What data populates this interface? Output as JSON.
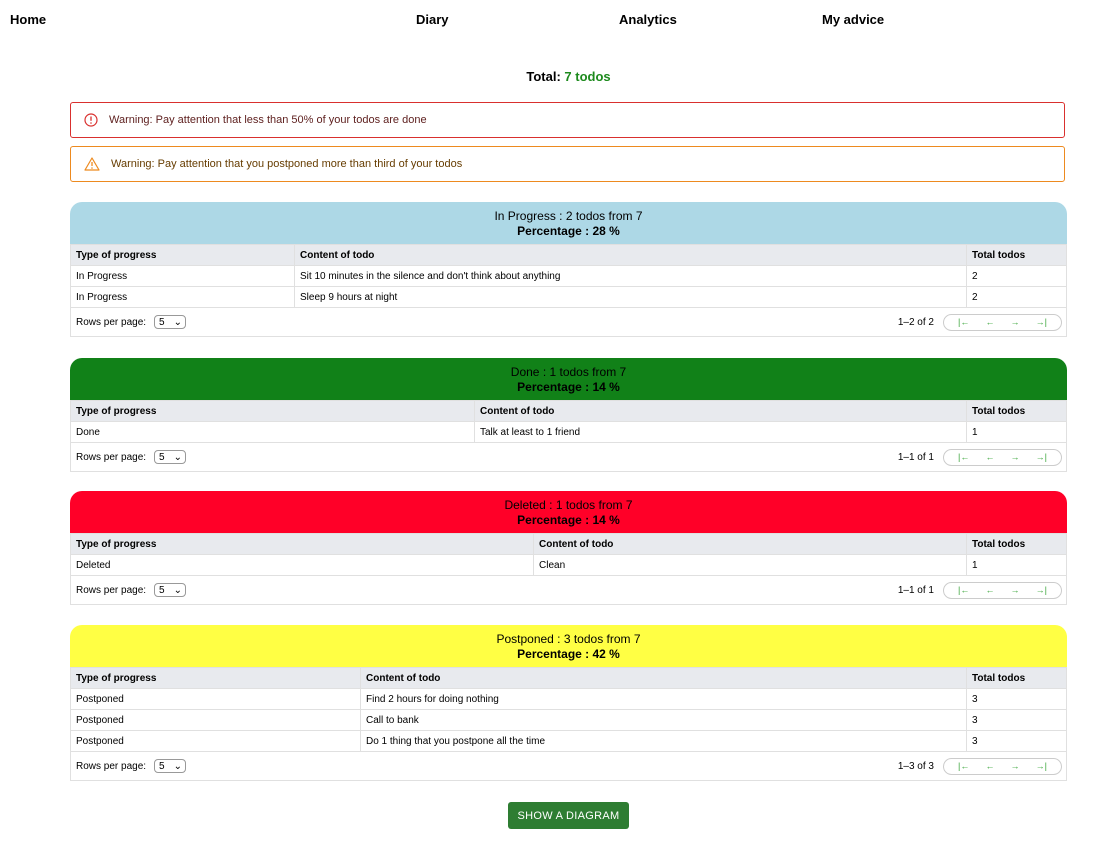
{
  "nav": {
    "home": "Home",
    "diary": "Diary",
    "analytics": "Analytics",
    "advice": "My advice"
  },
  "total": {
    "label": "Total:",
    "value": "7 todos"
  },
  "alerts": {
    "error": "Warning: Pay attention that less than 50% of your todos are done",
    "warning": "Warning: Pay attention that you postponed more than third of your todos"
  },
  "columns": {
    "type": "Type of progress",
    "content": "Content of todo",
    "total": "Total todos"
  },
  "rows_per_page_label": "Rows per page:",
  "rows_per_page_value": "5",
  "pager": {
    "first": "|←",
    "prev": "←",
    "next": "→",
    "last": "→|"
  },
  "groups": [
    {
      "title": "In Progress : 2 todos from 7",
      "percentage": "Percentage : 28 %",
      "color": "#add8e6",
      "range": "1–2 of 2",
      "rows": [
        {
          "type": "In Progress",
          "content": "Sit 10 minutes in the silence and don't think about anything",
          "total": "2"
        },
        {
          "type": "In Progress",
          "content": "Sleep 9 hours at night",
          "total": "2"
        }
      ]
    },
    {
      "title": "Done : 1 todos from 7",
      "percentage": "Percentage : 14 %",
      "color": "#118118",
      "range": "1–1 of 1",
      "rows": [
        {
          "type": "Done",
          "content": "Talk at least to 1 friend",
          "total": "1"
        }
      ]
    },
    {
      "title": "Deleted : 1 todos from 7",
      "percentage": "Percentage : 14 %",
      "color": "#ff0028",
      "range": "1–1 of 1",
      "rows": [
        {
          "type": "Deleted",
          "content": "Clean",
          "total": "1"
        }
      ]
    },
    {
      "title": "Postponed : 3 todos from 7",
      "percentage": "Percentage : 42 %",
      "color": "#ffff44",
      "range": "1–3 of 3",
      "rows": [
        {
          "type": "Postponed",
          "content": "Find 2 hours for doing nothing",
          "total": "3"
        },
        {
          "type": "Postponed",
          "content": "Call to bank",
          "total": "3"
        },
        {
          "type": "Postponed",
          "content": "Do 1 thing that you postpone all the time",
          "total": "3"
        }
      ]
    }
  ],
  "button": "SHOW A DIAGRAM"
}
